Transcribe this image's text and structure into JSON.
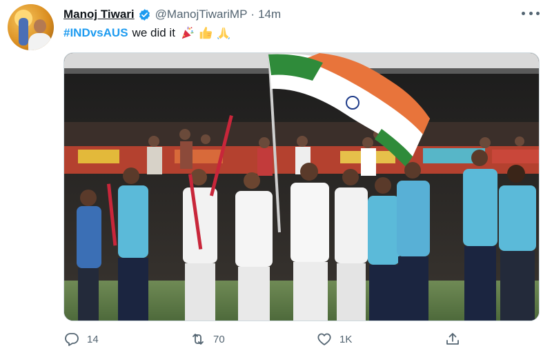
{
  "author": {
    "name": "Manoj Tiwari",
    "handle": "@ManojTiwariMP",
    "separator": "·",
    "time": "14m",
    "verified": true
  },
  "tweet": {
    "hashtag": "#INDvsAUS",
    "text": "we did it",
    "emojis": [
      "party-popper",
      "thumbs-up",
      "folded-hands"
    ]
  },
  "actions": {
    "replies": "14",
    "retweets": "70",
    "likes": "1K"
  },
  "colors": {
    "accent": "#1d9bf0",
    "secondary_text": "#536471",
    "primary_text": "#0f1419"
  }
}
